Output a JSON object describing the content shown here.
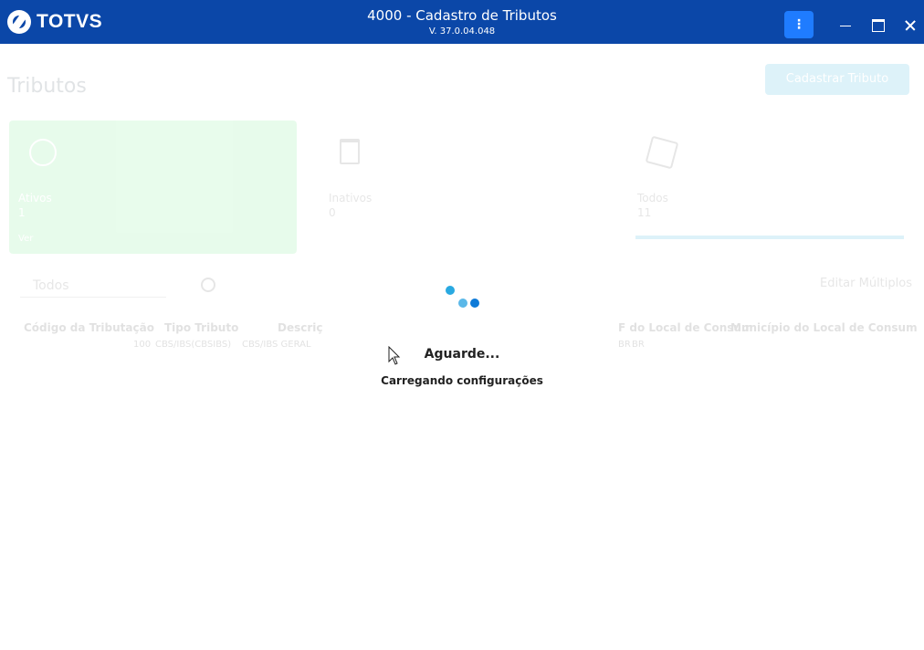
{
  "titlebar": {
    "logo_text": "TOTVS",
    "title": "4000 - Cadastro de Tributos",
    "version": "V. 37.0.04.048",
    "menu_glyph": "⋮"
  },
  "page": {
    "title": "Tributos",
    "primary_button": "Cadastrar Tributo"
  },
  "cards": {
    "active": {
      "label": "Ativos",
      "count": "1",
      "link": "Ver"
    },
    "inactive": {
      "label": "Inativos",
      "count": "0"
    },
    "all": {
      "label": "Todos",
      "count": "11",
      "progress": 1.0
    }
  },
  "filter": {
    "selected": "Todos",
    "edit_multiple": "Editar Múltiplos"
  },
  "table": {
    "columns": [
      "Código da Tributação",
      "Tipo Tributo",
      "Descriç",
      "F do Local de Consum",
      "Município do Local de Consum"
    ],
    "row": [
      "100",
      "CBS/IBS(CBSIBS)",
      "CBS/IBS GERAL",
      "BR",
      "BR"
    ]
  },
  "loader": {
    "title": "Aguarde...",
    "message": "Carregando configurações"
  },
  "colors": {
    "titlebar": "#0b47a8",
    "accent": "#1f7cff",
    "spinner": "#29a9e1"
  }
}
